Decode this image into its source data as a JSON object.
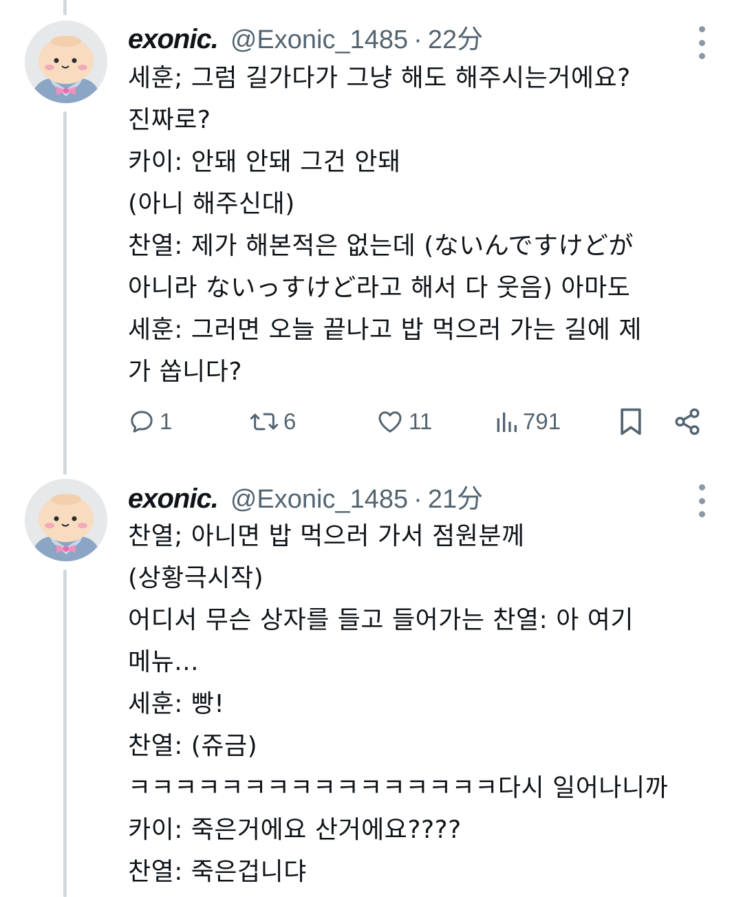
{
  "tweets": [
    {
      "display_name": "exonic.",
      "handle": "@Exonic_1485",
      "separator": "·",
      "time": "22分",
      "lines": [
        "세훈; 그럼 길가다가 그냥 해도 해주시는거에요?",
        "진짜로?",
        "카이: 안돼 안돼 그건 안돼",
        "(아니 해주신대)",
        "찬열: 제가 해본적은 없는데 (ないんですけどが",
        "아니라 ないっすけど라고 해서 다 웃음) 아마도",
        "세훈: 그러면 오늘 끝나고 밥 먹으러 가는 길에 제",
        "가 쏩니다?"
      ],
      "actions": {
        "replies": "1",
        "retweets": "6",
        "likes": "11",
        "views": "791"
      }
    },
    {
      "display_name": "exonic.",
      "handle": "@Exonic_1485",
      "separator": "·",
      "time": "21分",
      "lines": [
        "찬열; 아니면 밥 먹으러 가서 점원분께",
        "(상황극시작)",
        "어디서 무슨 상자를 들고 들어가는 찬열: 아 여기",
        "메뉴...",
        "세훈: 빵!",
        "찬열: (쥬금)",
        "ㅋㅋㅋㅋㅋㅋㅋㅋㅋㅋㅋㅋㅋㅋㅋㅋ다시 일어나니까",
        "카이: 죽은거에요 산거에요????",
        "찬열: 죽은겁니댜"
      ]
    }
  ],
  "icons": {
    "reply": "reply-icon",
    "retweet": "retweet-icon",
    "like": "heart-icon",
    "views": "views-icon",
    "bookmark": "bookmark-icon",
    "share": "share-icon",
    "more": "more-icon"
  },
  "colors": {
    "text": "#0f1419",
    "secondary": "#536471",
    "thread_line": "#cfd9de"
  }
}
